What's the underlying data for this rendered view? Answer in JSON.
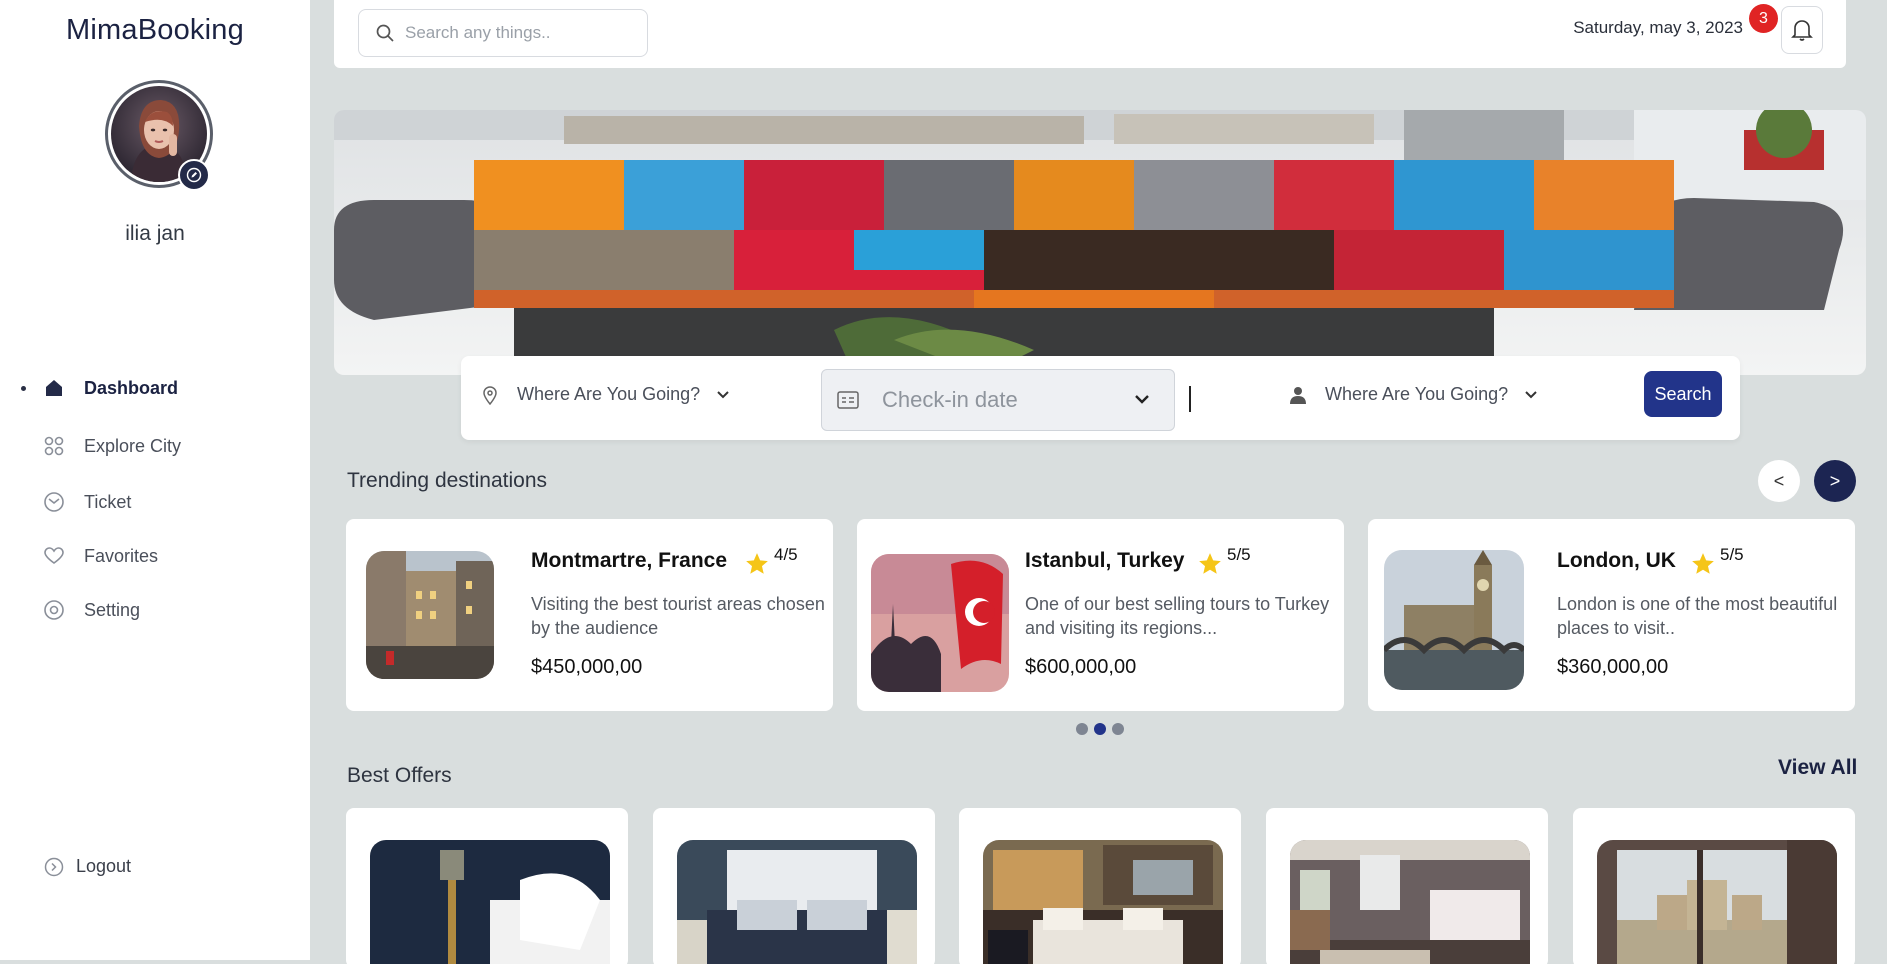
{
  "app": {
    "brand": "MimaBooking"
  },
  "user": {
    "name": "ilia jan"
  },
  "sidebar": {
    "items": [
      {
        "label": "Dashboard",
        "icon": "home-icon",
        "active": true
      },
      {
        "label": "Explore City",
        "icon": "grid-icon",
        "active": false
      },
      {
        "label": "Ticket",
        "icon": "envelope-icon",
        "active": false
      },
      {
        "label": "Favorites",
        "icon": "heart-icon",
        "active": false
      },
      {
        "label": "Setting",
        "icon": "settings-icon",
        "active": false
      }
    ],
    "logout_label": "Logout"
  },
  "topbar": {
    "search_placeholder": "Search any things..",
    "date": "Saturday, may 3, 2023",
    "notification_count": "3"
  },
  "booking": {
    "destination_label": "Where Are You Going?",
    "checkin_placeholder": "Check-in date",
    "guests_label": "Where Are You Going?",
    "search_label": "Search"
  },
  "trending": {
    "title": "Trending destinations",
    "prev_label": "<",
    "next_label": ">",
    "cards": [
      {
        "name": "Montmartre, France",
        "rating": "4/5",
        "description": "Visiting the best tourist areas chosen by the audience",
        "price": "$450,000,00"
      },
      {
        "name": "Istanbul, Turkey",
        "rating": "5/5",
        "description": "One of our best selling tours to Turkey and visiting its regions...",
        "price": "$600,000,00"
      },
      {
        "name": "London, UK",
        "rating": "5/5",
        "description": "London is one of the most beautiful places to visit..",
        "price": "$360,000,00"
      }
    ],
    "active_page": 2,
    "page_count": 3
  },
  "offers": {
    "title": "Best Offers",
    "view_all_label": "View All",
    "count": 5
  },
  "colors": {
    "accent": "#22348a",
    "dark_navy": "#1c2552",
    "page_bg": "#d9dede",
    "badge_red": "#e02424",
    "star": "#f5c518"
  }
}
